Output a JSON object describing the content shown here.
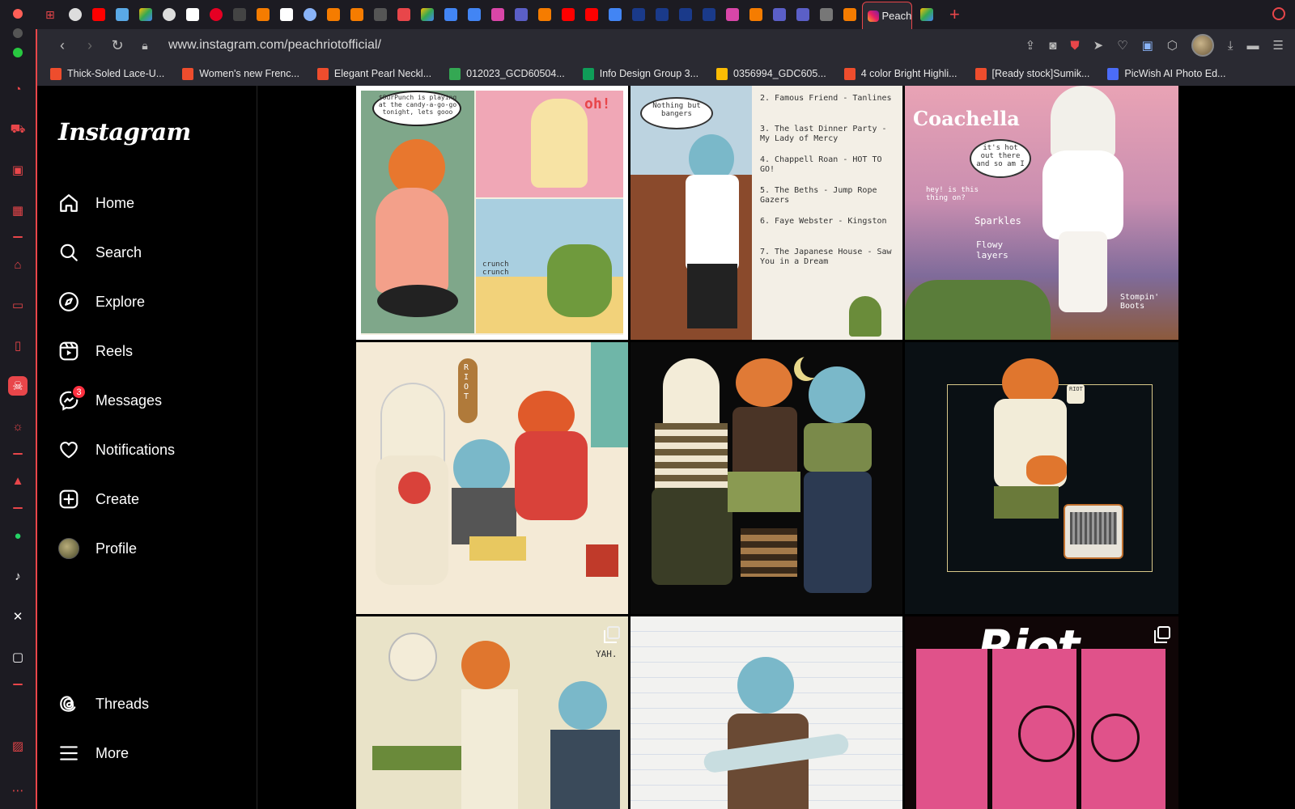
{
  "browser": {
    "active_tab_label": "Peach",
    "url": "www.instagram.com/peachriotofficial/",
    "bookmarks": [
      {
        "label": "Thick-Soled Lace-U...",
        "color": "#ee4d2d"
      },
      {
        "label": "Women's new Frenc...",
        "color": "#ee4d2d"
      },
      {
        "label": "Elegant Pearl Neckl...",
        "color": "#ee4d2d"
      },
      {
        "label": "012023_GCD60504...",
        "color": "#34a853"
      },
      {
        "label": "Info Design Group 3...",
        "color": "#0f9d58"
      },
      {
        "label": "0356994_GDC605...",
        "color": "#fbbc04"
      },
      {
        "label": "4 color Bright Highli...",
        "color": "#ee4d2d"
      },
      {
        "label": "[Ready stock]Sumik...",
        "color": "#ee4d2d"
      },
      {
        "label": "PicWish AI Photo Ed...",
        "color": "#4b6cf7"
      }
    ]
  },
  "instagram": {
    "logo": "Instagram",
    "nav": {
      "home": "Home",
      "search": "Search",
      "explore": "Explore",
      "reels": "Reels",
      "messages": "Messages",
      "messages_badge": "3",
      "notifications": "Notifications",
      "create": "Create",
      "profile": "Profile",
      "threads": "Threads",
      "more": "More"
    },
    "posts": {
      "p7_title": "Riot",
      "comic_text": "$OurPunch is playing at the candy-a-go-go tonight, lets gooo",
      "comic_oh": "oh!",
      "comic_crunch": "crunch crunch",
      "setlist_1": "Nothing but bangers",
      "setlist_2": "2. Famous Friend - Tanlines",
      "setlist_3": "3. The last Dinner Party - My Lady of Mercy",
      "setlist_4": "4. Chappell Roan - HOT TO GO!",
      "setlist_5": "5. The Beths - Jump Rope Gazers",
      "setlist_6": "6. Faye Webster - Kingston",
      "setlist_7": "7. The Japanese House - Saw You in a Dream",
      "coachella": "Coachella",
      "coachella_1": "it's hot out there and so am I",
      "coachella_2": "hey! is this thing on?",
      "coachella_3": "Sparkles",
      "coachella_4": "Flowy layers",
      "coachella_5": "Stompin' Boots",
      "band_sign": "RIOT",
      "guitar_sign": "RIOT",
      "yah": "YAH."
    }
  }
}
